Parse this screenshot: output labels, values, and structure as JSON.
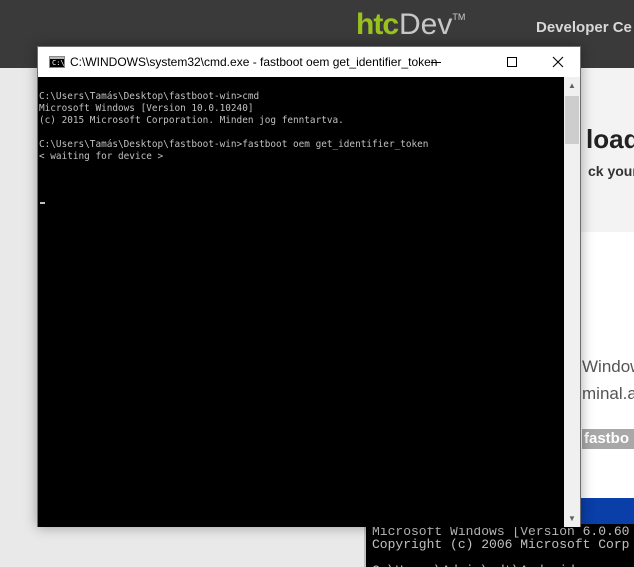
{
  "website": {
    "logo_htc": "htc",
    "logo_dev": "Dev",
    "logo_tm": "TM",
    "header_link": "Developer Ce",
    "heading_fragment": "load",
    "sub_fragment": "ck your",
    "text_fragment_1": "Window",
    "text_fragment_2": "minal.a",
    "code_fragment": "fastbo",
    "embedded_cmd_lines": "Microsoft Windows [Version 6.0.60\nCopyright (c) 2006 Microsoft Corp\n\nC:\\Users\\Admin\\adt\\Android"
  },
  "window": {
    "title": "C:\\WINDOWS\\system32\\cmd.exe - fastboot  oem get_identifier_token",
    "icon_label": "C:\\"
  },
  "console": {
    "text": "C:\\Users\\Tamás\\Desktop\\fastboot-win>cmd\nMicrosoft Windows [Version 10.0.10240]\n(c) 2015 Microsoft Corporation. Minden jog fenntartva.\n\nC:\\Users\\Tamás\\Desktop\\fastboot-win>fastboot oem get_identifier_token\n< waiting for device >"
  },
  "scrollbar": {
    "up_glyph": "▲",
    "down_glyph": "▼"
  },
  "colors": {
    "console_bg": "#000000",
    "console_fg": "#c0c0c0",
    "htc_green": "#99c31c",
    "header_bg": "#3a3a3a"
  }
}
